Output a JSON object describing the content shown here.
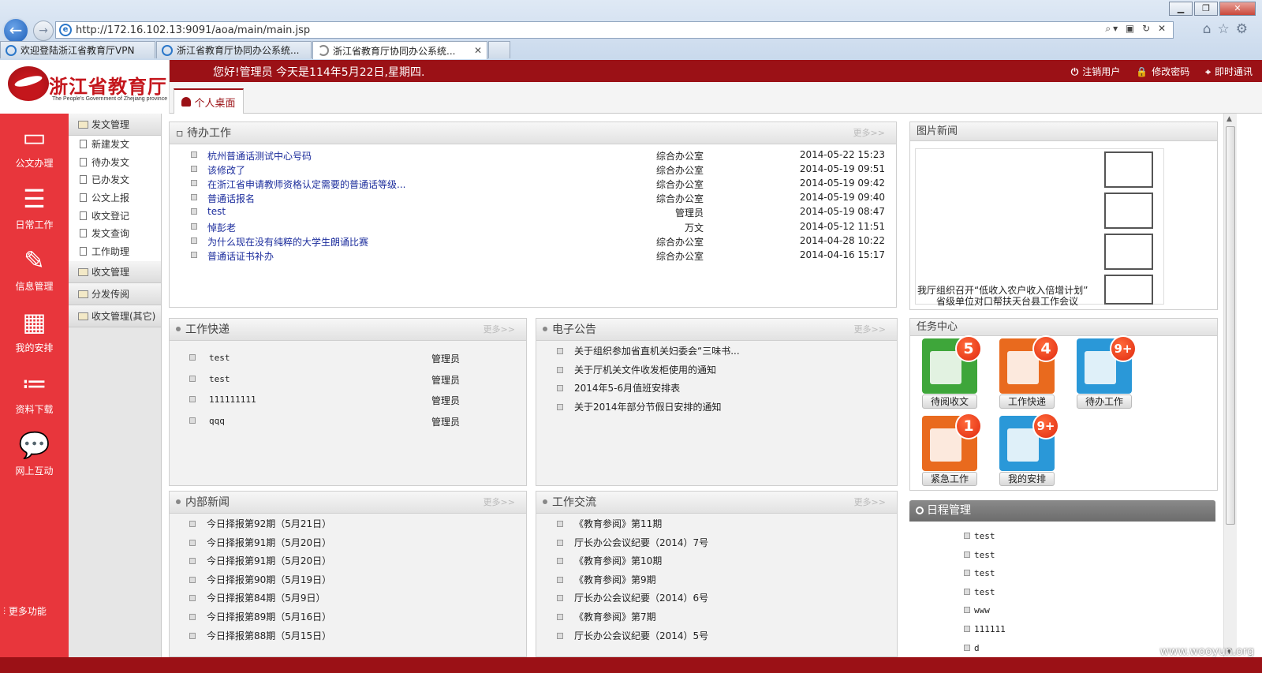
{
  "browser": {
    "url": "http://172.16.102.13:9091/aoa/main/main.jsp",
    "tabs": [
      {
        "label": "欢迎登陆浙江省教育厅VPN"
      },
      {
        "label": "浙江省教育厅协同办公系统..."
      },
      {
        "label": "浙江省教育厅协同办公系统..."
      }
    ]
  },
  "header": {
    "logo_title": "浙江省教育厅",
    "logo_sub": "The People's Government of Zhejiang province",
    "greeting": "您好!管理员 今天是114年5月22日,星期四.",
    "links": [
      "注销用户",
      "修改密码",
      "即时通讯"
    ],
    "home_tab": "个人桌面"
  },
  "rail": [
    "公文办理",
    "日常工作",
    "信息管理",
    "我的安排",
    "资料下载",
    "网上互动"
  ],
  "rail_more": "更多功能",
  "submenu": {
    "group1": "发文管理",
    "items": [
      "新建发文",
      "待办发文",
      "已办发文",
      "公文上报",
      "收文登记",
      "发文查询",
      "工作助理"
    ],
    "groups": [
      "收文管理",
      "分发传阅",
      "收文管理(其它)"
    ]
  },
  "todo": {
    "title": "待办工作",
    "more": "更多>>",
    "rows": [
      {
        "title": "杭州普通话测试中心号码",
        "dept": "综合办公室",
        "time": "2014-05-22 15:23"
      },
      {
        "title": "该修改了",
        "dept": "综合办公室",
        "time": "2014-05-19 09:51"
      },
      {
        "title": "在浙江省申请教师资格认定需要的普通话等级...",
        "dept": "综合办公室",
        "time": "2014-05-19 09:42"
      },
      {
        "title": "普通话报名",
        "dept": "综合办公室",
        "time": "2014-05-19 09:40"
      },
      {
        "title": "test",
        "dept": "管理员",
        "time": "2014-05-19 08:47"
      },
      {
        "title": "悼彭老",
        "dept": "万文",
        "time": "2014-05-12 11:51"
      },
      {
        "title": "为什么现在没有纯粹的大学生朗诵比赛",
        "dept": "综合办公室",
        "time": "2014-04-28 10:22"
      },
      {
        "title": "普通话证书补办",
        "dept": "综合办公室",
        "time": "2014-04-16 15:17"
      }
    ]
  },
  "express": {
    "title": "工作快递",
    "more": "更多>>",
    "rows": [
      {
        "title": "test",
        "who": "管理员"
      },
      {
        "title": "test",
        "who": "管理员"
      },
      {
        "title": "111111111",
        "who": "管理员"
      },
      {
        "title": "qqq",
        "who": "管理员"
      }
    ]
  },
  "notice": {
    "title": "电子公告",
    "more": "更多>>",
    "rows": [
      "关于组织参加省直机关妇委会“三味书...",
      "关于厅机关文件收发柜使用的通知",
      "2014年5-6月值班安排表",
      "关于2014年部分节假日安排的通知"
    ]
  },
  "news": {
    "title": "内部新闻",
    "more": "更多>>",
    "rows": [
      "今日择报第92期（5月21日）",
      "今日择报第91期（5月20日）",
      "今日择报第91期（5月20日）",
      "今日择报第90期（5月19日）",
      "今日择报第84期（5月9日）",
      "今日择报第89期（5月16日）",
      "今日择报第88期（5月15日）"
    ]
  },
  "exchange": {
    "title": "工作交流",
    "more": "更多>>",
    "rows": [
      "《教育参阅》第11期",
      "厅长办公会议纪要（2014）7号",
      "《教育参阅》第10期",
      "《教育参阅》第9期",
      "厅长办公会议纪要（2014）6号",
      "《教育参阅》第7期",
      "厅长办公会议纪要（2014）5号"
    ]
  },
  "picnews": {
    "title": "图片新闻",
    "caption1": "我厅组织召开“低收入农户收入倍增计划”",
    "caption2": "省级单位对口帮扶天台县工作会议"
  },
  "tasks": {
    "title": "任务中心",
    "tiles": [
      {
        "label": "待阅收文",
        "count": "5",
        "color": "#3ea63a"
      },
      {
        "label": "工作快递",
        "count": "4",
        "color": "#e96a1e"
      },
      {
        "label": "待办工作",
        "count": "9+",
        "color": "#2a98d8"
      },
      {
        "label": "紧急工作",
        "count": "1",
        "color": "#e96a1e"
      },
      {
        "label": "我的安排",
        "count": "9+",
        "color": "#2a98d8"
      }
    ]
  },
  "schedule": {
    "title": "日程管理",
    "rows": [
      "test",
      "test",
      "test",
      "test",
      "www",
      "111111",
      "d"
    ]
  },
  "watermark": "www.wooyun.org"
}
